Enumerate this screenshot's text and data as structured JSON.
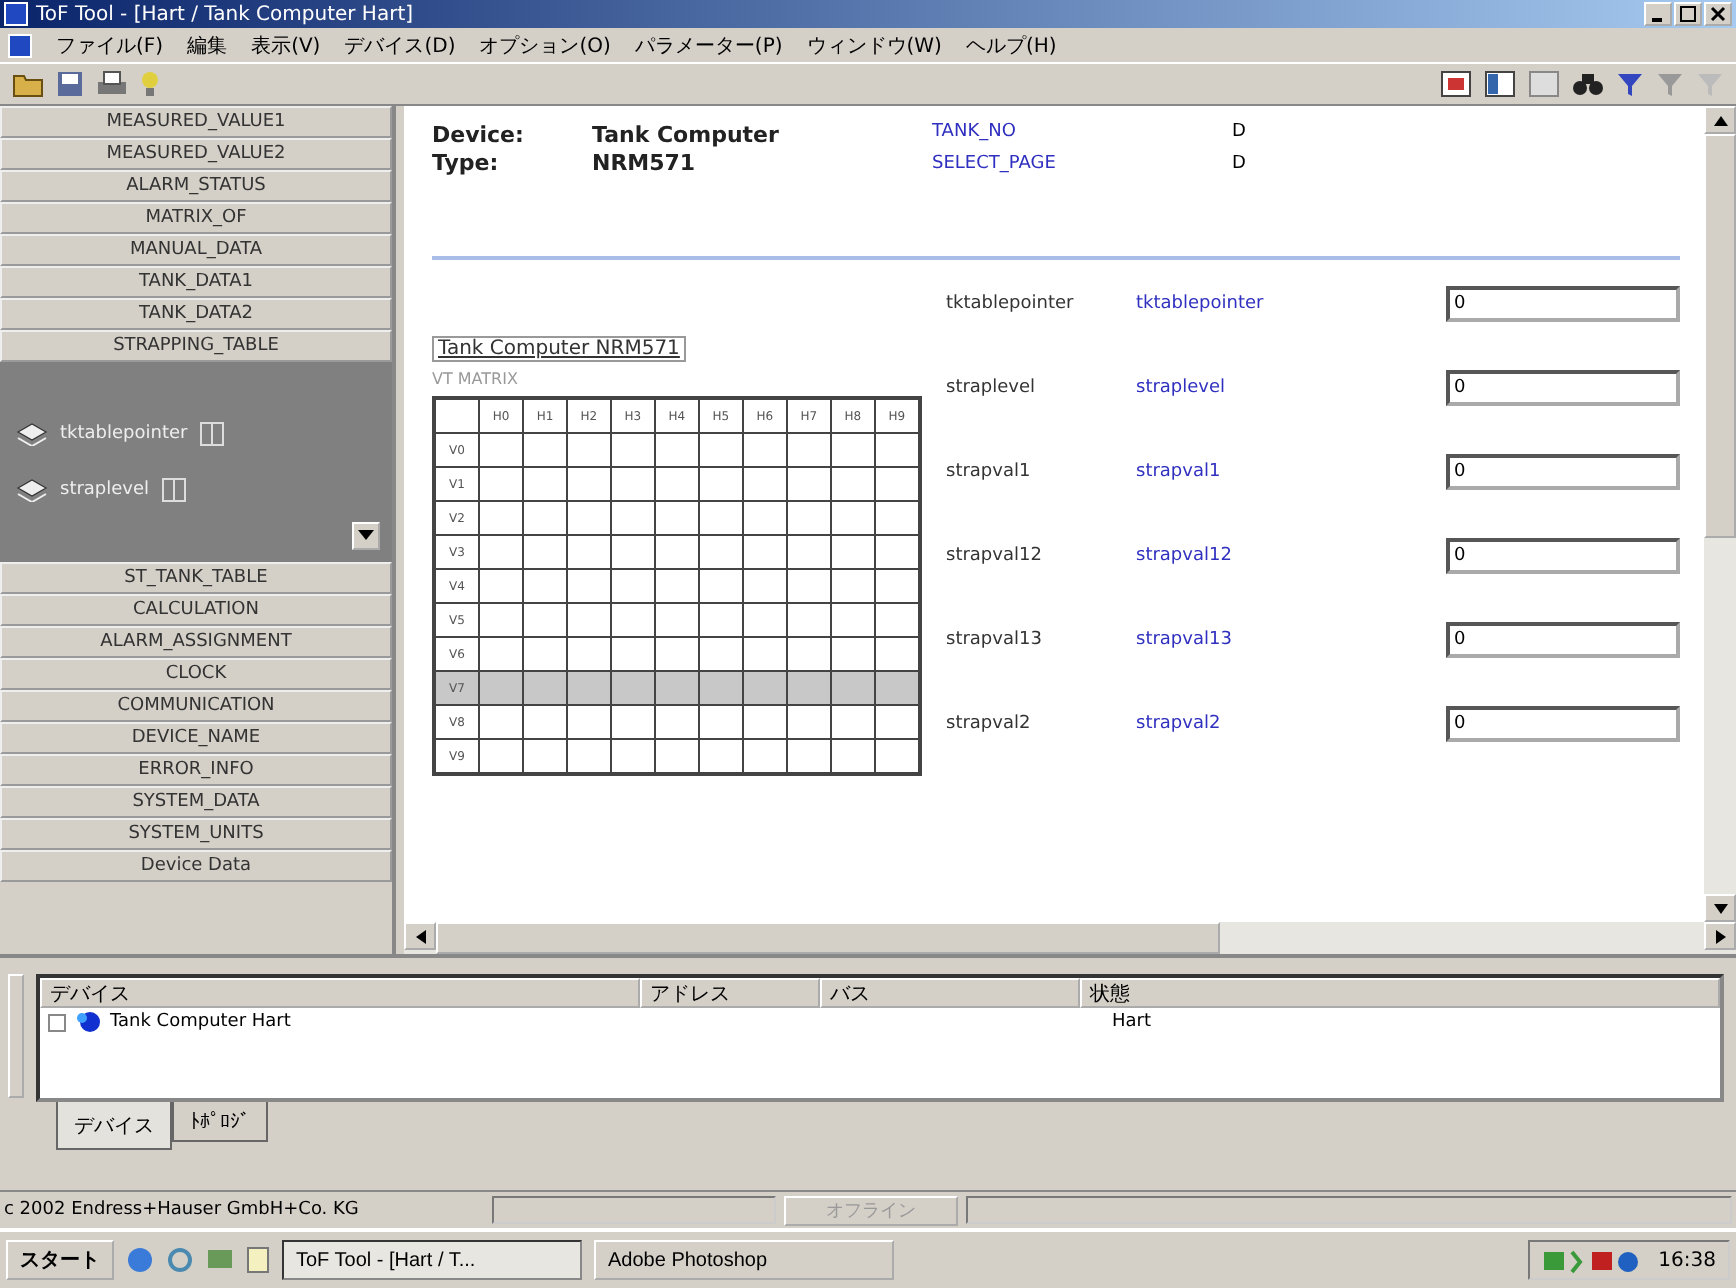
{
  "window": {
    "title": "ToF Tool - [Hart / Tank Computer Hart]"
  },
  "menu": [
    "ファイル(F)",
    "編集",
    "表示(V)",
    "デバイス(D)",
    "オプション(O)",
    "パラメーター(P)",
    "ウィンドウ(W)",
    "ヘルプ(H)"
  ],
  "sidebar": {
    "items_before": [
      "MEASURED_VALUE1",
      "MEASURED_VALUE2",
      "ALARM_STATUS",
      "MATRIX_OF",
      "MANUAL_DATA",
      "TANK_DATA1",
      "TANK_DATA2",
      "STRAPPING_TABLE"
    ],
    "expanded": [
      {
        "label": "tktablepointer"
      },
      {
        "label": "straplevel"
      }
    ],
    "items_after": [
      "ST_TANK_TABLE",
      "CALCULATION",
      "ALARM_ASSIGNMENT",
      "CLOCK",
      "COMMUNICATION",
      "DEVICE_NAME",
      "ERROR_INFO",
      "SYSTEM_DATA",
      "SYSTEM_UNITS",
      "Device Data"
    ]
  },
  "header": {
    "device_label": "Device:",
    "device": "Tank Computer",
    "type_label": "Type:",
    "type": "NRM571",
    "params": [
      {
        "name": "TANK_NO",
        "value": "D"
      },
      {
        "name": "SELECT_PAGE",
        "value": "D"
      }
    ]
  },
  "matrix": {
    "title": "Tank Computer NRM571",
    "subtitle": "VT MATRIX",
    "columns": [
      "H0",
      "H1",
      "H2",
      "H3",
      "H4",
      "H5",
      "H6",
      "H7",
      "H8",
      "H9"
    ],
    "rows": [
      {
        "label": "V0",
        "selected": false
      },
      {
        "label": "V1",
        "selected": false
      },
      {
        "label": "V2",
        "selected": false
      },
      {
        "label": "V3",
        "selected": false
      },
      {
        "label": "V4",
        "selected": false
      },
      {
        "label": "V5",
        "selected": false
      },
      {
        "label": "V6",
        "selected": false
      },
      {
        "label": "V7",
        "selected": true
      },
      {
        "label": "V8",
        "selected": false
      },
      {
        "label": "V9",
        "selected": false
      }
    ]
  },
  "parameters": [
    {
      "label": "tktablepointer",
      "name": "tktablepointer",
      "value": "0"
    },
    {
      "label": "straplevel",
      "name": "straplevel",
      "value": "0"
    },
    {
      "label": "strapval1",
      "name": "strapval1",
      "value": "0"
    },
    {
      "label": "strapval12",
      "name": "strapval12",
      "value": "0"
    },
    {
      "label": "strapval13",
      "name": "strapval13",
      "value": "0"
    },
    {
      "label": "strapval2",
      "name": "strapval2",
      "value": "0"
    }
  ],
  "device_list": {
    "columns": [
      "デバイス",
      "アドレス",
      "バス",
      "状態"
    ],
    "rows": [
      {
        "name": "Tank Computer Hart",
        "address": "",
        "bus": "",
        "status": "Hart"
      }
    ]
  },
  "bottom_tabs": [
    {
      "label": "デバイス",
      "selected": true
    },
    {
      "label": "ﾄﾎﾟﾛｼﾞ",
      "selected": false
    }
  ],
  "status_bar": {
    "copyright": "c 2002 Endress+Hauser GmbH+Co. KG",
    "mode": "オフライン"
  },
  "taskbar": {
    "start": "スタート",
    "tasks": [
      {
        "label": "ToF Tool - [Hart / T...",
        "selected": true
      },
      {
        "label": "Adobe Photoshop",
        "selected": false
      }
    ],
    "clock": "16:38"
  }
}
